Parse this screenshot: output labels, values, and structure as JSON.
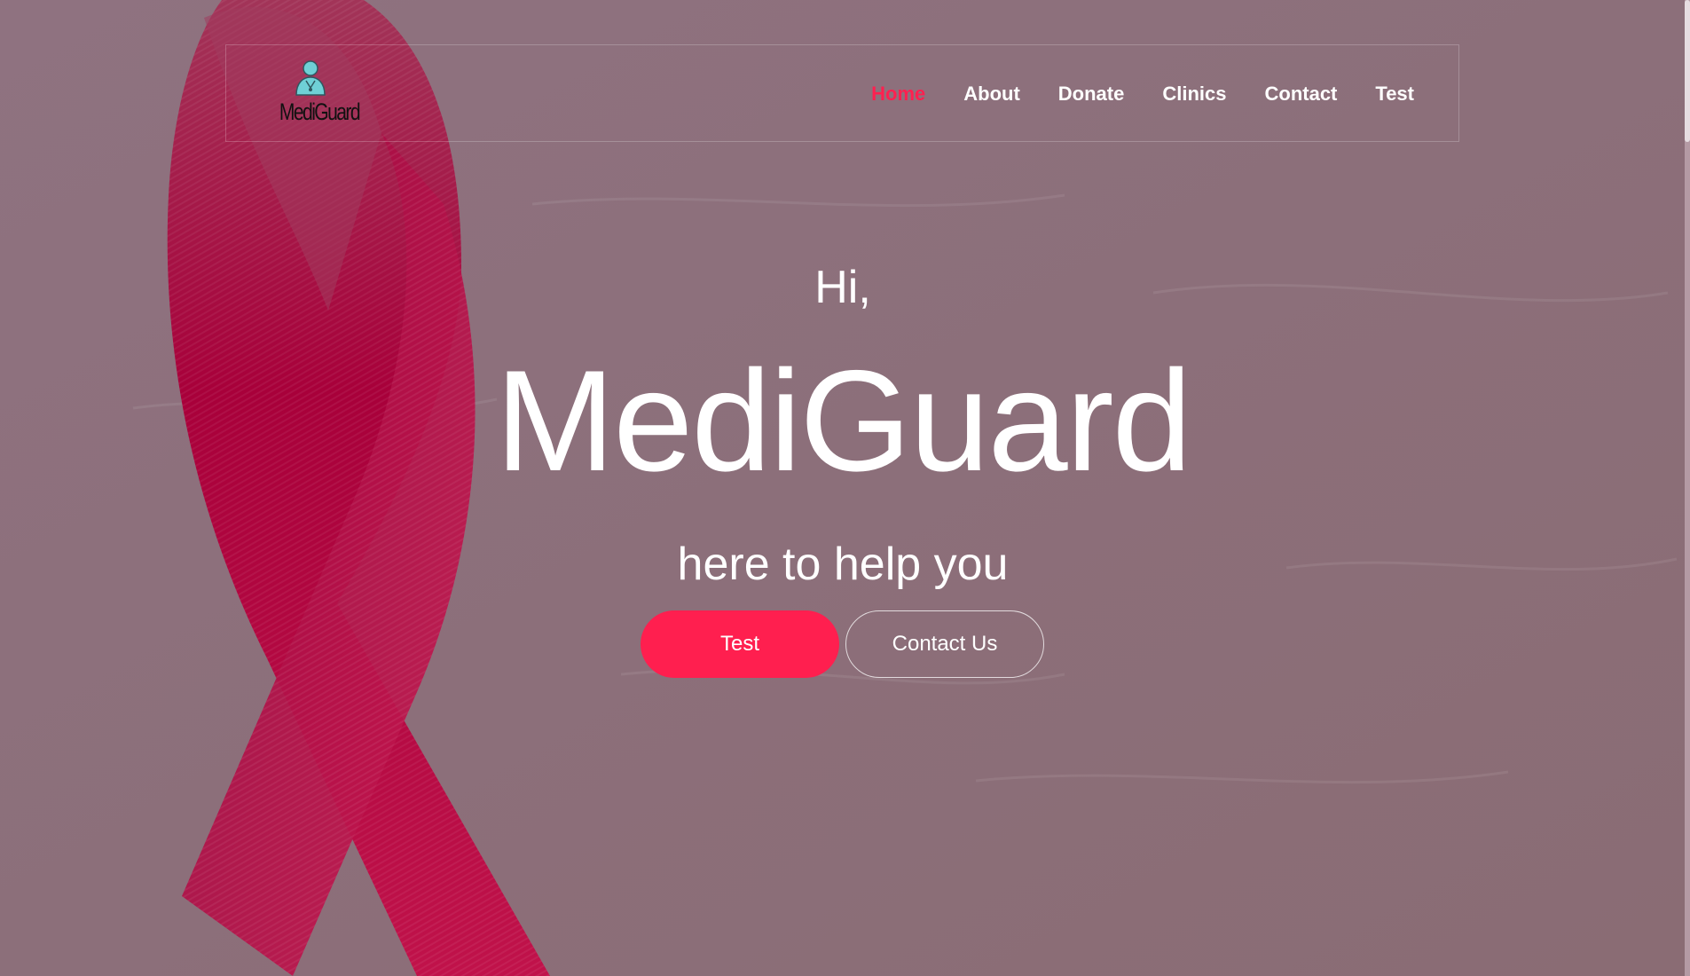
{
  "brand": {
    "logo_text": "MediGuard",
    "logo_icon": "doctor-avatar-icon",
    "accent_color": "#ff1f4f"
  },
  "nav": {
    "items": [
      {
        "label": "Home",
        "active": true
      },
      {
        "label": "About",
        "active": false
      },
      {
        "label": "Donate",
        "active": false
      },
      {
        "label": "Clinics",
        "active": false
      },
      {
        "label": "Contact",
        "active": false
      },
      {
        "label": "Test",
        "active": false
      }
    ]
  },
  "hero": {
    "greeting": "Hi,",
    "title": "MediGuard",
    "tagline": "here to help you",
    "primary_button": "Test",
    "secondary_button": "Contact Us",
    "background_image": "red-awareness-ribbon"
  }
}
